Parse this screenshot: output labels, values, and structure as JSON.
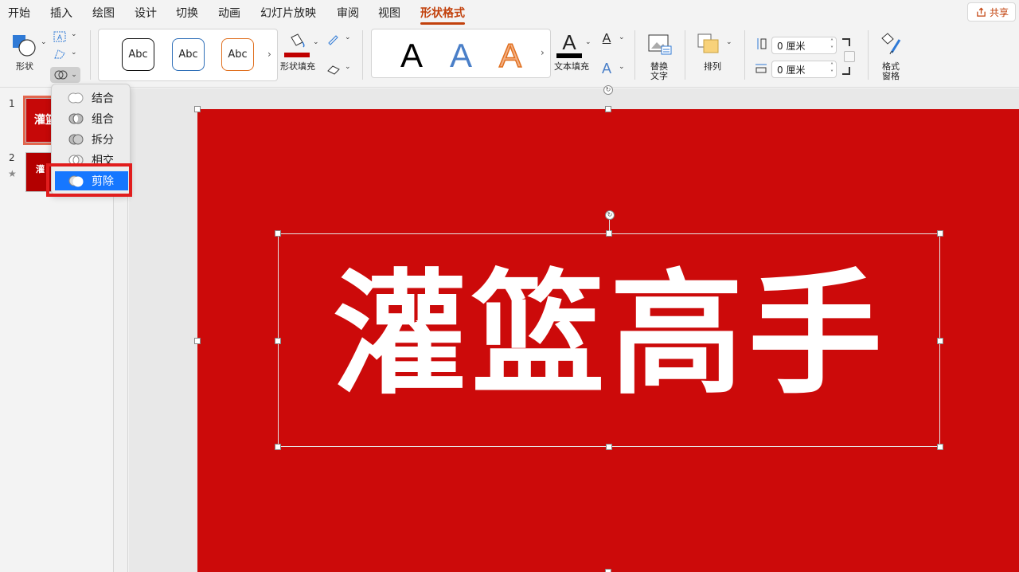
{
  "tabs": [
    "开始",
    "插入",
    "绘图",
    "设计",
    "切换",
    "动画",
    "幻灯片放映",
    "审阅",
    "视图",
    "形状格式"
  ],
  "active_tab": "形状格式",
  "share_label": "共享",
  "ribbon": {
    "shape_label": "形状",
    "style_gallery": [
      "Abc",
      "Abc",
      "Abc"
    ],
    "shape_fill_label": "形状填充",
    "wordart_gallery": [
      "A",
      "A",
      "A"
    ],
    "text_fill_label": "文本填充",
    "alt_text_label_line1": "替换",
    "alt_text_label_line2": "文字",
    "arrange_label": "排列",
    "height_value": "0 厘米",
    "width_value": "0 厘米",
    "format_pane_label_line1": "格式",
    "format_pane_label_line2": "窗格",
    "fill_color": "#c00000"
  },
  "thumbnails": [
    {
      "number": "1",
      "text": "灌篮"
    },
    {
      "number": "2",
      "text": "灌"
    }
  ],
  "slide": {
    "title": "灌篮高手",
    "background": "#cc0a0a"
  },
  "merge_menu": {
    "items": [
      "结合",
      "组合",
      "拆分",
      "相交",
      "剪除"
    ],
    "highlighted": "剪除"
  }
}
